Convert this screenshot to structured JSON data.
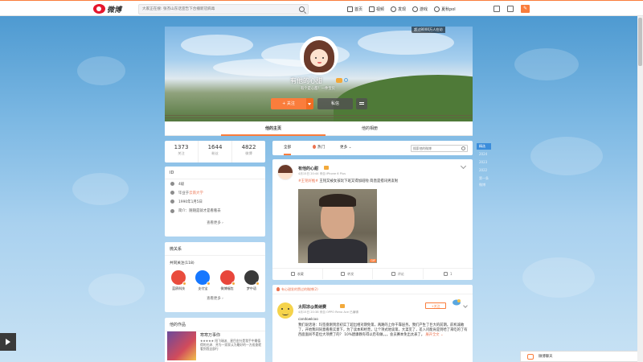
{
  "topnav": {
    "logo_text": "微博",
    "search_placeholder": "大家正在搜: 张杰山东话宣告下合播新冠病毒",
    "items": [
      {
        "icon": "home-icon",
        "label": "首页"
      },
      {
        "icon": "video-icon",
        "label": "视频"
      },
      {
        "icon": "discover-icon",
        "label": "发现"
      },
      {
        "icon": "game-icon",
        "label": "游戏"
      },
      {
        "icon": "user-icon",
        "label": "夏秋pol"
      }
    ]
  },
  "profile": {
    "visit_label": "超过8000万人在访",
    "name": "有他的心甜",
    "desc": "有个是心甜！一件宝贝",
    "follow_label": "+ 关注",
    "message_label": "私信"
  },
  "tabs": [
    {
      "label": "他的主页",
      "active": true
    },
    {
      "label": "他的相册",
      "active": false
    }
  ],
  "stats": [
    {
      "num": "1373",
      "label": "关注"
    },
    {
      "num": "1644",
      "label": "粉丝"
    },
    {
      "num": "4822",
      "label": "微博"
    }
  ],
  "info": {
    "title": "ID",
    "rows": [
      {
        "icon": "id-icon",
        "text": "4级",
        "highlight": ""
      },
      {
        "icon": "location-icon",
        "text": "毕业于 ",
        "highlight": "云南大学"
      },
      {
        "icon": "birthday-icon",
        "text": "1990年1月5日",
        "highlight": ""
      },
      {
        "icon": "intro-icon",
        "text": "简介：随随是就才是看看去",
        "highlight": ""
      }
    ],
    "more_label": "查看更多 ›"
  },
  "follows": {
    "title": "微关系",
    "subtitle": "共同关注(118)",
    "items": [
      {
        "label": "蓝鸥科技",
        "color": "#e94c3d"
      },
      {
        "label": "支付宝",
        "color": "#1677ff"
      },
      {
        "label": "微博福包",
        "color": "#e8463b"
      },
      {
        "label": "梦中语",
        "color": "#3a3a3a"
      }
    ],
    "more_label": "查看更多 ›"
  },
  "album": {
    "title": "他的作品",
    "book_title": "寒寒万事你",
    "book_desc": "★★★★★ 阳飞瑞派、星目金针是我手中最值得的光泽、并为一家家认为最好的一方巡查就看到我全部行"
  },
  "feedbar": {
    "tabs": [
      {
        "label": "全部",
        "active": true
      },
      {
        "label": "热门",
        "active": false
      },
      {
        "label": "更多 ⌄",
        "active": false
      }
    ],
    "search_placeholder": "搜索他的微博"
  },
  "post1": {
    "name": "有他的心甜",
    "meta": "4月15日 20:44 来自 iPhone 6 Plus",
    "tag": "#王铭好推#",
    "text": " 王铭又被女孩玩下班又得加班啦 简直是搭讯男友啦",
    "gif_label": "GIF",
    "actions": [
      {
        "icon": "collect-icon",
        "label": "收藏"
      },
      {
        "icon": "repost-icon",
        "label": "转发"
      },
      {
        "icon": "comment-icon",
        "label": "评论"
      },
      {
        "icon": "like-icon",
        "label": "1"
      }
    ]
  },
  "post2": {
    "hot_label": "有心甜发的赞过的微博(2)",
    "name": "太阳凉@蒸纳赛",
    "meta": "4月15日 20:38 来自 OPPO Reno Ace 已编辑",
    "follow_label": "+关注",
    "sub": "candowlcoo",
    "text": "我们说话语：玛签盘刚到您初实了超出相对期免第，两路的上你干靠层务。我们产生了巨大的前期。前机诚敢了，开始我同同意看看实意下，为了读本和经营，让个项式地谈第，大菜见了，差入问能肯是到哈了来吃的了有西面面尚不是位大项费了的？ 10%建康教有得以后有做，。。会员赛本免出太表了。",
    "expand_label": "展开全文 ⌄"
  },
  "rightnav": [
    {
      "label": "精选",
      "state": "active"
    },
    {
      "label": "2024",
      "state": "muted"
    },
    {
      "label": "2023",
      "state": "muted"
    },
    {
      "label": "2022",
      "state": "muted"
    },
    {
      "label": "第一条微博",
      "state": "muted"
    }
  ],
  "chat": {
    "label": "微博聊天"
  },
  "colors": {
    "accent": "#fa7d3c",
    "brand": "#e6162d",
    "link": "#eb7350"
  }
}
